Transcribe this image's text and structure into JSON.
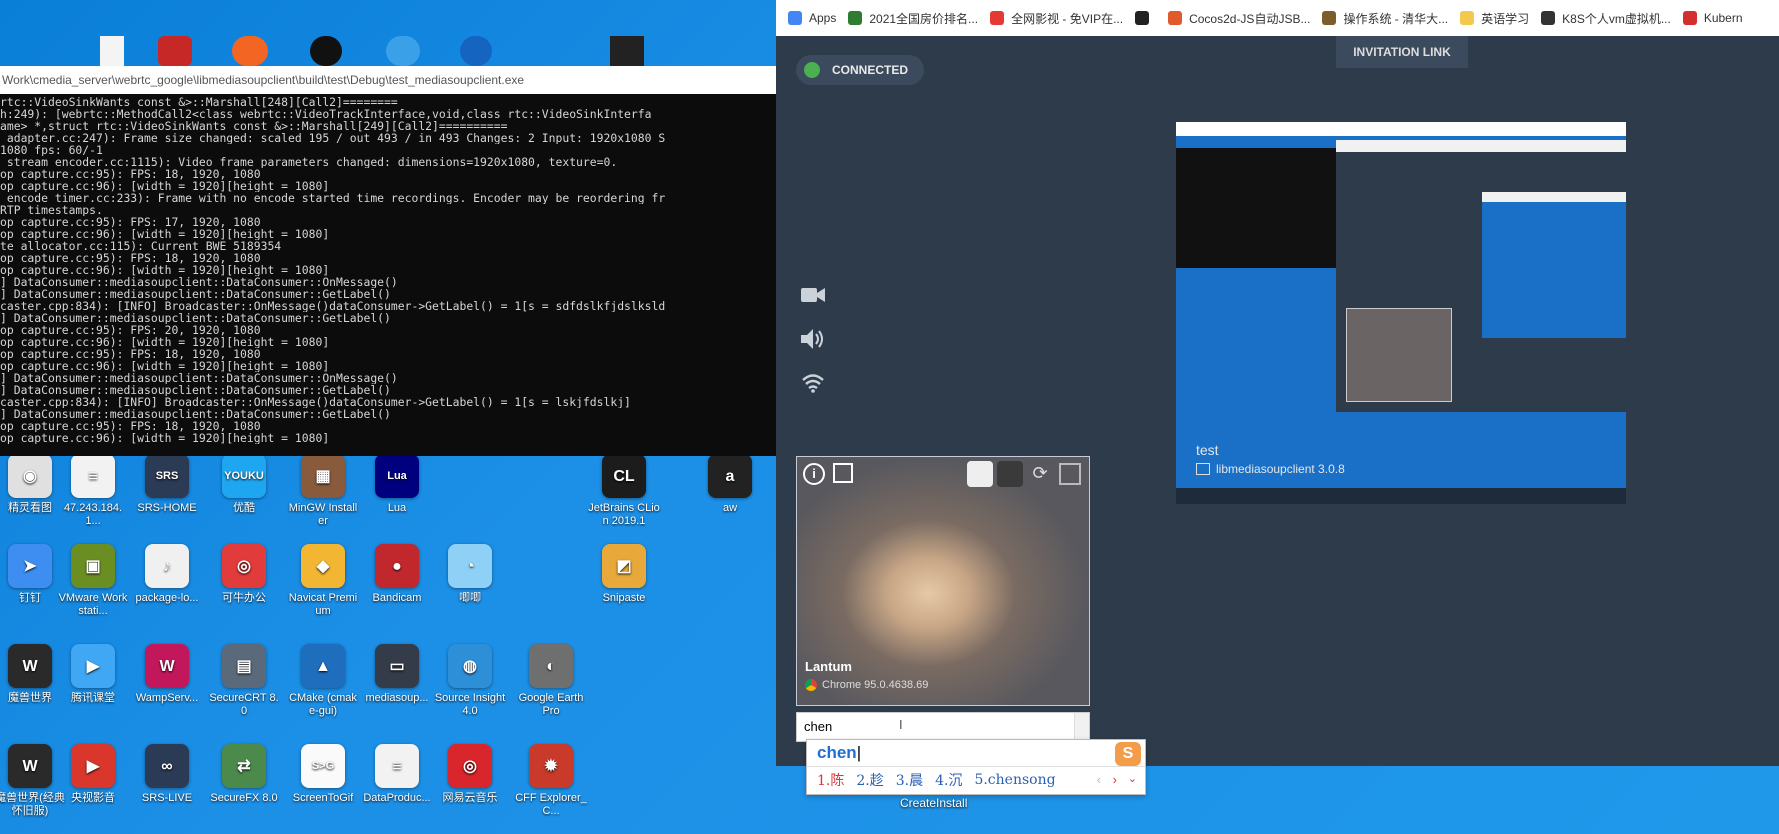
{
  "console": {
    "title": "Work\\cmedia_server\\webrtc_google\\libmediasoupclient\\build\\test\\Debug\\test_mediasoupclient.exe",
    "lines": [
      "rtc::VideoSinkWants const &>::Marshall[248][Call2]========",
      "h:249): [webrtc::MethodCall2<class webrtc::VideoTrackInterface,void,class rtc::VideoSinkInterfa",
      "ame> *,struct rtc::VideoSinkWants const &>::Marshall[249][Call2]==========",
      "_adapter.cc:247): Frame size changed: scaled 195 / out 493 / in 493 Changes: 2 Input: 1920x1080 S",
      "1080 fps: 60/-1",
      "_stream_encoder.cc:1115): Video frame parameters changed: dimensions=1920x1080, texture=0.",
      "op_capture.cc:95): FPS: 18, 1920, 1080",
      "op_capture.cc:96): [width = 1920][height = 1080]",
      "_encode_timer.cc:233): Frame with no encode started time recordings. Encoder may be reordering fr",
      "RTP timestamps.",
      "op_capture.cc:95): FPS: 17, 1920, 1080",
      "op_capture.cc:96): [width = 1920][height = 1080]",
      "te_allocator.cc:115): Current BWE 5189354",
      "op_capture.cc:95): FPS: 18, 1920, 1080",
      "op_capture.cc:96): [width = 1920][height = 1080]",
      "] DataConsumer::mediasoupclient::DataConsumer::OnMessage()",
      "] DataConsumer::mediasoupclient::DataConsumer::GetLabel()",
      "caster.cpp:834): [INFO] Broadcaster::OnMessage()dataConsumer->GetLabel() = 1[s = sdfdslkfjdslksld",
      "] DataConsumer::mediasoupclient::DataConsumer::GetLabel()",
      "op_capture.cc:95): FPS: 20, 1920, 1080",
      "op_capture.cc:96): [width = 1920][height = 1080]",
      "op_capture.cc:95): FPS: 18, 1920, 1080",
      "op_capture.cc:96): [width = 1920][height = 1080]",
      "] DataConsumer::mediasoupclient::DataConsumer::OnMessage()",
      "] DataConsumer::mediasoupclient::DataConsumer::GetLabel()",
      "caster.cpp:834): [INFO] Broadcaster::OnMessage()dataConsumer->GetLabel() = 1[s = lskjfdslkj]",
      "] DataConsumer::mediasoupclient::DataConsumer::GetLabel()",
      "op_capture.cc:95): FPS: 18, 1920, 1080",
      "op_capture.cc:96): [width = 1920][height = 1080]"
    ]
  },
  "desktop_icons": [
    {
      "label": "精灵看图",
      "color": "#e0e0e0",
      "glyph": "◉"
    },
    {
      "label": "47.243.184.1...",
      "color": "#f2f2f2",
      "glyph": "≡"
    },
    {
      "label": "SRS-HOME",
      "color": "#2b3a55",
      "glyph": "SRS"
    },
    {
      "label": "优酷",
      "color": "#1ea6f0",
      "glyph": "YOUKU"
    },
    {
      "label": "MinGW Installer",
      "color": "#8a5a3c",
      "glyph": "▦"
    },
    {
      "label": "Lua",
      "color": "#00007f",
      "glyph": "Lua"
    },
    {
      "label": "JetBrains CLion 2019.1",
      "color": "#1c1c1c",
      "glyph": "CL"
    },
    {
      "label": "aw",
      "color": "#222",
      "glyph": "a"
    },
    {
      "label": "钉钉",
      "color": "#3d8ef0",
      "glyph": "➤"
    },
    {
      "label": "VMware Workstati...",
      "color": "#6b8e23",
      "glyph": "▣"
    },
    {
      "label": "package-lo...",
      "color": "#f0f0f0",
      "glyph": "♪"
    },
    {
      "label": "可牛办公",
      "color": "#e23b3b",
      "glyph": "◎"
    },
    {
      "label": "Navicat Premium",
      "color": "#f2b632",
      "glyph": "◆"
    },
    {
      "label": "Bandicam",
      "color": "#c0282e",
      "glyph": "●"
    },
    {
      "label": "唧唧",
      "color": "#8fd0f7",
      "glyph": "◔"
    },
    {
      "label": "Snipaste",
      "color": "#e8a93a",
      "glyph": "◩"
    },
    {
      "label": "魔兽世界",
      "color": "#2a2a2a",
      "glyph": "W"
    },
    {
      "label": "腾讯课堂",
      "color": "#3fa7f3",
      "glyph": "▶"
    },
    {
      "label": "WampServ...",
      "color": "#c2185b",
      "glyph": "W"
    },
    {
      "label": "SecureCRT 8.0",
      "color": "#5a6a7a",
      "glyph": "▤"
    },
    {
      "label": "CMake (cmake-gui)",
      "color": "#1f6dbd",
      "glyph": "▲"
    },
    {
      "label": "mediasoup...",
      "color": "#333c48",
      "glyph": "▭"
    },
    {
      "label": "Source Insight 4.0",
      "color": "#2d8fd8",
      "glyph": "◍"
    },
    {
      "label": "Google Earth Pro",
      "color": "#6f6f6f",
      "glyph": "◐"
    },
    {
      "label": "魔兽世界(经典怀旧服)",
      "color": "#2a2a2a",
      "glyph": "W"
    },
    {
      "label": "央视影音",
      "color": "#d9362c",
      "glyph": "▶"
    },
    {
      "label": "SRS-LIVE",
      "color": "#2b3a55",
      "glyph": "∞"
    },
    {
      "label": "SecureFX 8.0",
      "color": "#4b8a4b",
      "glyph": "⇄"
    },
    {
      "label": "ScreenToGif",
      "color": "#fafafa",
      "glyph": "S>G"
    },
    {
      "label": "DataProduc...",
      "color": "#f2f2f2",
      "glyph": "≡"
    },
    {
      "label": "网易云音乐",
      "color": "#d9262c",
      "glyph": "◎"
    },
    {
      "label": "CFF Explorer_C...",
      "color": "#c93a2a",
      "glyph": "✹"
    }
  ],
  "bookmarks": [
    {
      "label": "Apps",
      "color": "#4285f4"
    },
    {
      "label": "2021全国房价排名...",
      "color": "#2e7d32"
    },
    {
      "label": "全网影视 - 免VIP在...",
      "color": "#e53935"
    },
    {
      "label": "",
      "color": "#222222"
    },
    {
      "label": "Cocos2d-JS自动JSB...",
      "color": "#e05a2b"
    },
    {
      "label": "操作系统 - 清华大...",
      "color": "#7b5e2b"
    },
    {
      "label": "英语学习",
      "color": "#f2c94c"
    },
    {
      "label": "K8S个人vm虚拟机...",
      "color": "#333333"
    },
    {
      "label": "Kubern",
      "color": "#d32f2f"
    }
  ],
  "app": {
    "status": "CONNECTED",
    "invitation_link": "INVITATION LINK",
    "remote_peer": {
      "name": "test",
      "version": "libmediasoupclient 3.0.8"
    },
    "local_peer": {
      "name": "Lantum",
      "browser": "Chrome 95.0.4638.69"
    },
    "chat_input_value": "chen"
  },
  "ime": {
    "composition": "chen",
    "candidates": [
      "1.陈",
      "2.趁",
      "3.晨",
      "4.沉",
      "5.chensong"
    ]
  },
  "desktop_below": {
    "label": "CreateInstall"
  }
}
